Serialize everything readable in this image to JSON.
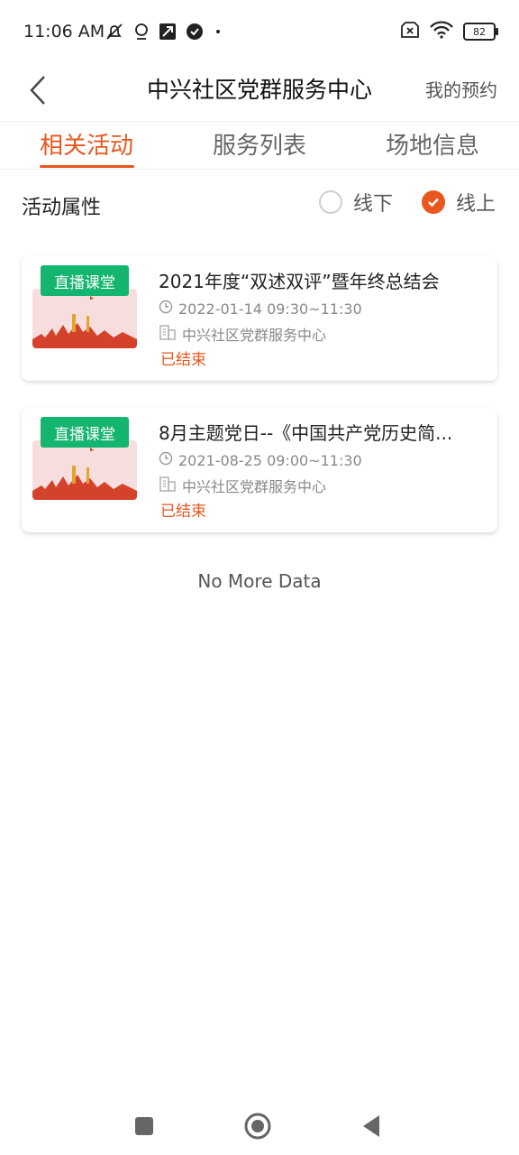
{
  "status_bar": {
    "time": "11:06 AM",
    "battery": "82",
    "left_icons": [
      "mute-bell-icon",
      "location-icon",
      "app-icon",
      "check-badge-icon",
      "dot-icon"
    ],
    "right_icons": [
      "no-sim-icon",
      "wifi-icon",
      "battery-icon"
    ]
  },
  "header": {
    "title": "中兴社区党群服务中心",
    "right_link": "我的预约",
    "back_icon": "chevron-left-icon"
  },
  "tabs": [
    {
      "label": "相关活动",
      "active": true
    },
    {
      "label": "服务列表",
      "active": false
    },
    {
      "label": "场地信息",
      "active": false
    }
  ],
  "filter": {
    "label": "活动属性",
    "options": [
      {
        "label": "线下",
        "checked": false
      },
      {
        "label": "线上",
        "checked": true
      }
    ]
  },
  "activities": [
    {
      "badge": "直播课堂",
      "title": "2021年度“双述双评”暨年终总结会",
      "time": "2022-01-14 09:30~11:30",
      "venue": "中兴社区党群服务中心",
      "status": "已结束"
    },
    {
      "badge": "直播课堂",
      "title": "8月主题党日--《中国共产党历史简...",
      "time": "2021-08-25 09:00~11:30",
      "venue": "中兴社区党群服务中心",
      "status": "已结束"
    }
  ],
  "footer": {
    "no_more": "No More Data"
  },
  "colors": {
    "accent": "#e8571e",
    "badge": "#14b56e"
  }
}
